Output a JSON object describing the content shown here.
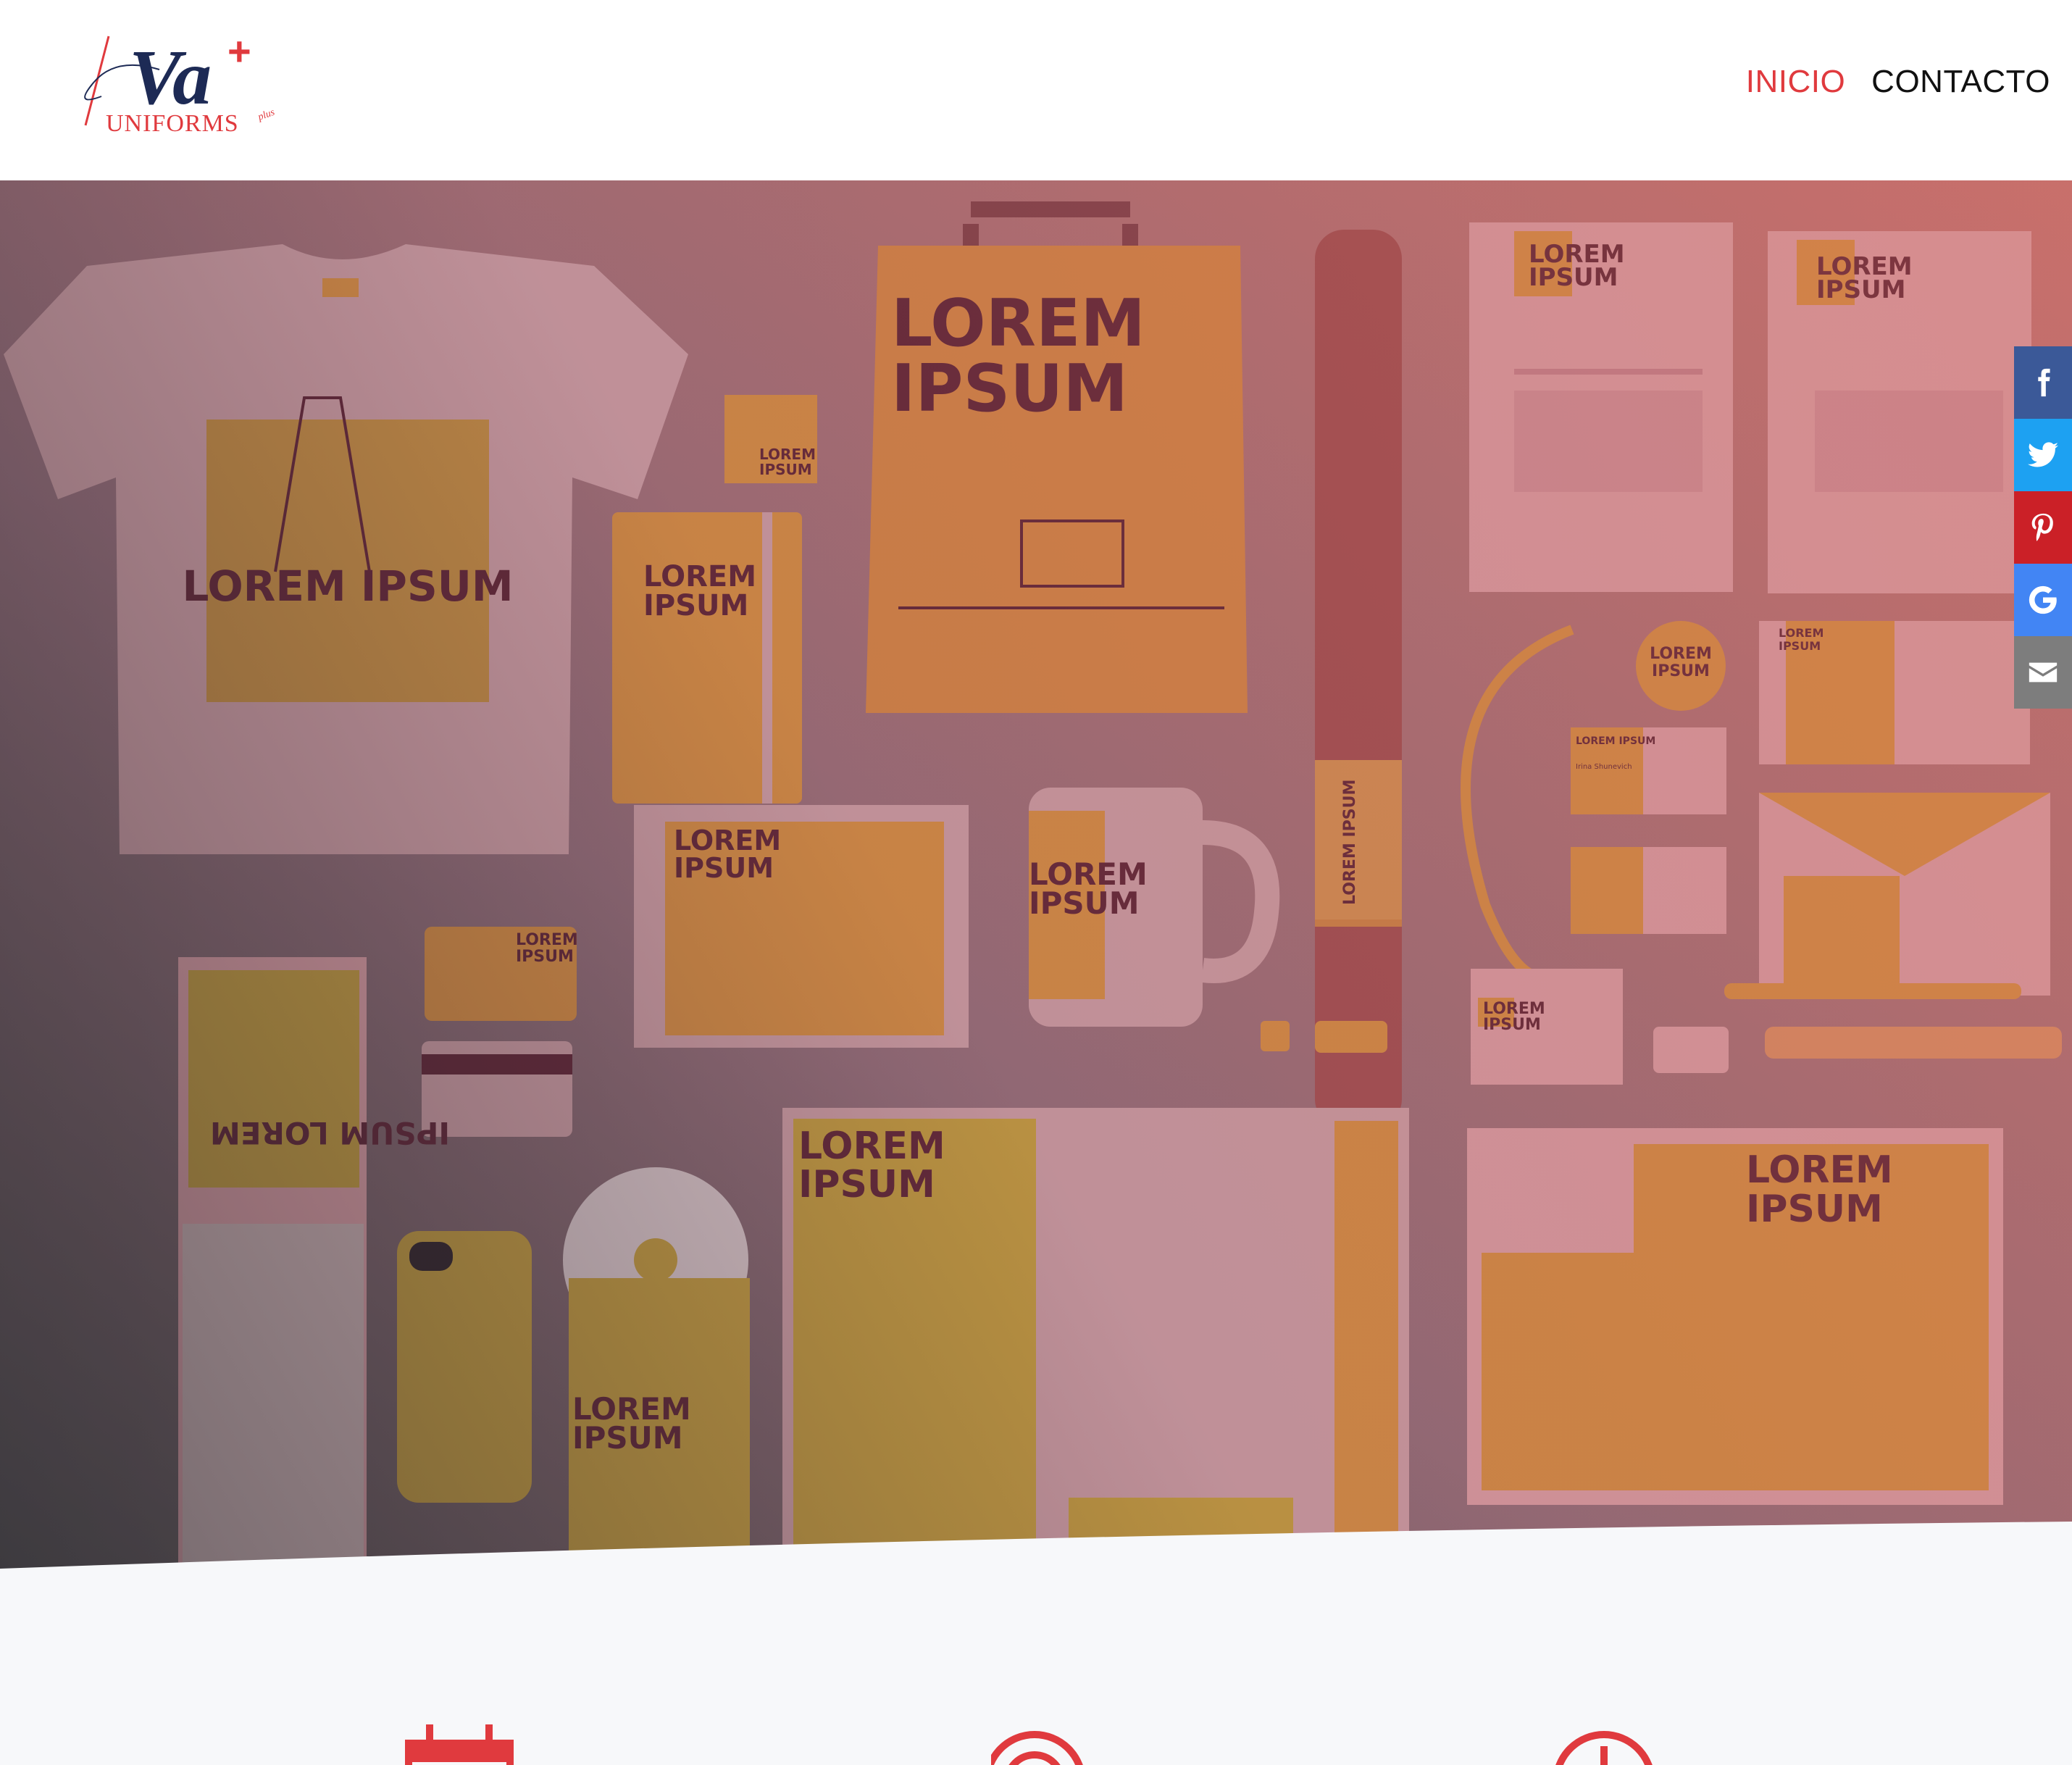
{
  "brand": {
    "logo_main": "Va",
    "logo_plus": "+",
    "logo_sub": "UNIFORMS",
    "logo_tag": "plus",
    "primary_color": "#e03a3e",
    "navy_color": "#1d2a55"
  },
  "nav": {
    "items": [
      {
        "label": "INICIO",
        "active": true
      },
      {
        "label": "CONTACTO",
        "active": false
      }
    ]
  },
  "hero": {
    "mockup_text": {
      "lorem": "LOREM",
      "ipsum": "IPSUM",
      "lorem_ipsum": "LOREM IPSUM",
      "lorem_ipsum_rev": "IPSUM LOREM",
      "person": "Irina Shunevich"
    },
    "colors": {
      "orange": "#d08a3e",
      "mustard": "#bf9a3a",
      "pink": "#c89aa0",
      "dark": "#5a2131"
    }
  },
  "share": {
    "items": [
      {
        "name": "facebook",
        "icon": "facebook-icon",
        "color": "#3b5998"
      },
      {
        "name": "twitter",
        "icon": "twitter-icon",
        "color": "#1da1f2"
      },
      {
        "name": "pinterest",
        "icon": "pinterest-icon",
        "color": "#cb2027"
      },
      {
        "name": "google",
        "icon": "google-icon",
        "color": "#4285f4"
      },
      {
        "name": "email",
        "icon": "envelope-icon",
        "color": "#7d7d7d"
      }
    ]
  },
  "features": {
    "icons": [
      "calendar-icon",
      "target-icon",
      "clock-icon"
    ],
    "color": "#e03a3e"
  }
}
